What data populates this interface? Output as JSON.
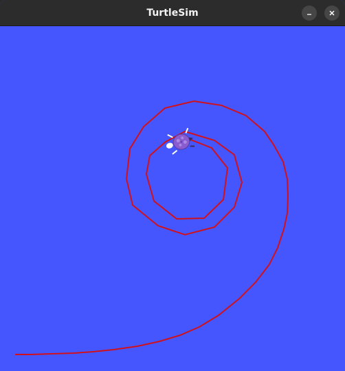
{
  "window": {
    "title": "TurtleSim"
  },
  "titlebar_buttons": {
    "minimize_icon": "minimize-icon",
    "close_icon": "close-icon"
  },
  "canvas": {
    "background_color": "#4556ff",
    "pen_color": "#d0111b",
    "turtle_color": "#8a5cd0"
  }
}
